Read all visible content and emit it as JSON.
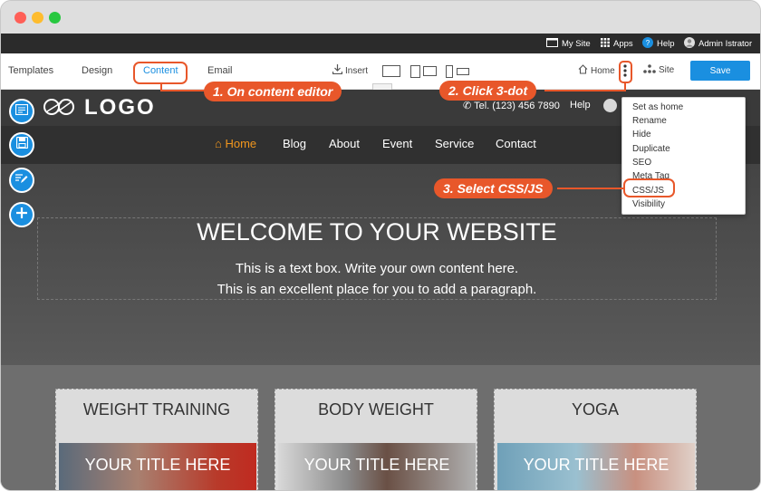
{
  "window": {
    "controls": [
      "close",
      "minimize",
      "maximize"
    ]
  },
  "topbar": {
    "my_site": "My Site",
    "apps": "Apps",
    "help": "Help",
    "user": "Admin Istrator"
  },
  "toolbar": {
    "tabs": [
      "Templates",
      "Design",
      "Content",
      "Email"
    ],
    "active_tab": "Content",
    "insert": "Insert",
    "home": "Home",
    "site": "Site",
    "save": "Save"
  },
  "site": {
    "logo_text": "LOGO",
    "tel": "Tel. (123) 456 7890",
    "help": "Help",
    "nav": [
      "Home",
      "Blog",
      "About",
      "Event",
      "Service",
      "Contact"
    ],
    "hero_title": "WELCOME TO YOUR WEBSITE",
    "hero_line1": "This is a text box. Write your own content here.",
    "hero_line2": "This is an excellent place for you to add a paragraph.",
    "cards": [
      {
        "title": "WEIGHT TRAINING",
        "image_title": "YOUR TITLE HERE"
      },
      {
        "title": "BODY WEIGHT",
        "image_title": "YOUR TITLE HERE"
      },
      {
        "title": "YOGA",
        "image_title": "YOUR TITLE HERE"
      }
    ]
  },
  "menu": {
    "items": [
      "Set as home",
      "Rename",
      "Hide",
      "Duplicate",
      "SEO",
      "Meta Tag",
      "CSS/JS",
      "Visibility"
    ]
  },
  "callouts": {
    "step1": "1. On content editor",
    "step2": "2. Click 3-dot",
    "step3": "3. Select CSS/JS"
  },
  "colors": {
    "accent": "#1a8fe0",
    "highlight": "#e8572a",
    "nav_active": "#f0961e"
  },
  "icons": {
    "side_buttons": [
      "page-icon",
      "save-icon",
      "edit-icon",
      "plus-icon"
    ]
  }
}
